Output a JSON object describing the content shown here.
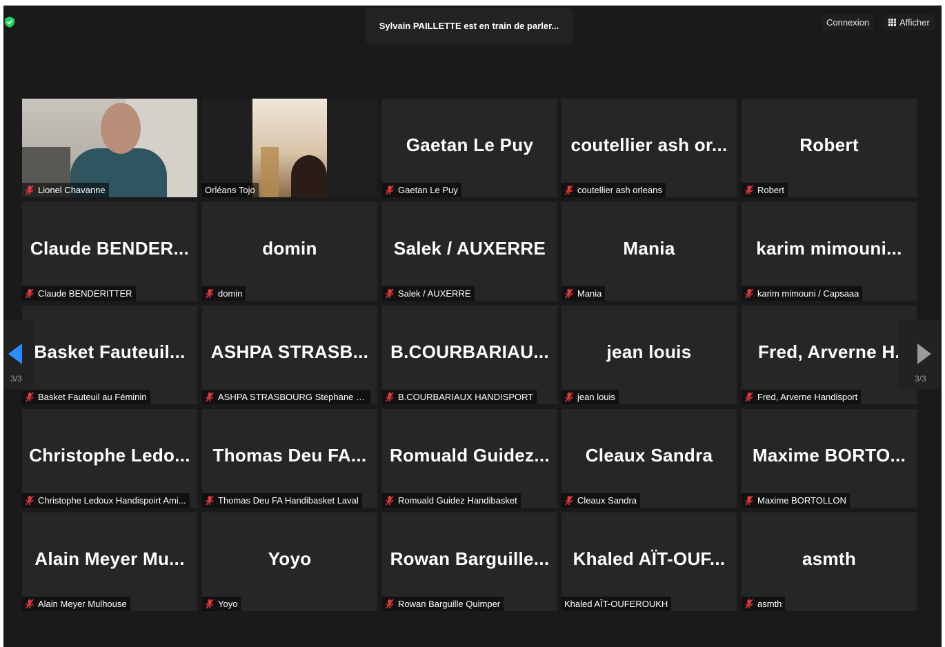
{
  "topbar": {
    "speaking": "Sylvain PAILLETTE est en train de parler...",
    "login": "Connexion",
    "view": "Afficher"
  },
  "pagination": {
    "left": "3/3",
    "right": "3/3"
  },
  "tiles": [
    {
      "big": "",
      "label": "Lionel Chavanne",
      "muted": true,
      "video": true
    },
    {
      "big": "",
      "label": "Orléans Tojo",
      "muted": false,
      "video": true
    },
    {
      "big": "Gaetan Le Puy",
      "label": "Gaetan Le Puy",
      "muted": true
    },
    {
      "big": "coutellier ash or...",
      "label": "coutellier ash orleans",
      "muted": true
    },
    {
      "big": "Robert",
      "label": "Robert",
      "muted": true
    },
    {
      "big": "Claude BENDER...",
      "label": "Claude BENDERITTER",
      "muted": true
    },
    {
      "big": "domin",
      "label": "domin",
      "muted": true
    },
    {
      "big": "Salek / AUXERRE",
      "label": "Salek / AUXERRE",
      "muted": true
    },
    {
      "big": "Mania",
      "label": "Mania",
      "muted": true
    },
    {
      "big": "karim mimouni...",
      "label": "karim mimouni / Capsaaa",
      "muted": true
    },
    {
      "big": "Basket Fauteuil...",
      "label": "Basket Fauteuil au Féminin",
      "muted": true
    },
    {
      "big": "ASHPA STRASB...",
      "label": "ASHPA STRASBOURG Stephane KN...",
      "muted": true
    },
    {
      "big": "B.COURBARIAU...",
      "label": "B.COURBARIAUX HANDISPORT",
      "muted": true
    },
    {
      "big": "jean louis",
      "label": "jean louis",
      "muted": true
    },
    {
      "big": "Fred, Arverne H.",
      "label": "Fred, Arverne Handisport",
      "muted": true
    },
    {
      "big": "Christophe Ledo...",
      "label": "Christophe Ledoux Handispoirt Ami...",
      "muted": true
    },
    {
      "big": "Thomas Deu FA...",
      "label": "Thomas Deu FA Handibasket Laval",
      "muted": true
    },
    {
      "big": "Romuald Guidez...",
      "label": "Romuald Guidez Handibasket",
      "muted": true
    },
    {
      "big": "Cleaux Sandra",
      "label": "Cleaux Sandra",
      "muted": true
    },
    {
      "big": "Maxime BORTO...",
      "label": "Maxime BORTOLLON",
      "muted": true
    },
    {
      "big": "Alain Meyer Mu...",
      "label": "Alain Meyer Mulhouse",
      "muted": true
    },
    {
      "big": "Yoyo",
      "label": "Yoyo",
      "muted": true
    },
    {
      "big": "Rowan Barguille...",
      "label": "Rowan Barguille Quimper",
      "muted": true
    },
    {
      "big": "Khaled AÏT-OUF...",
      "label": "Khaled AÏT-OUFEROUKH",
      "muted": false
    },
    {
      "big": "asmth",
      "label": "asmth",
      "muted": true
    }
  ],
  "colors": {
    "accent": "#2d8cff",
    "muted_icon": "#e5383b",
    "shield": "#23d160"
  }
}
